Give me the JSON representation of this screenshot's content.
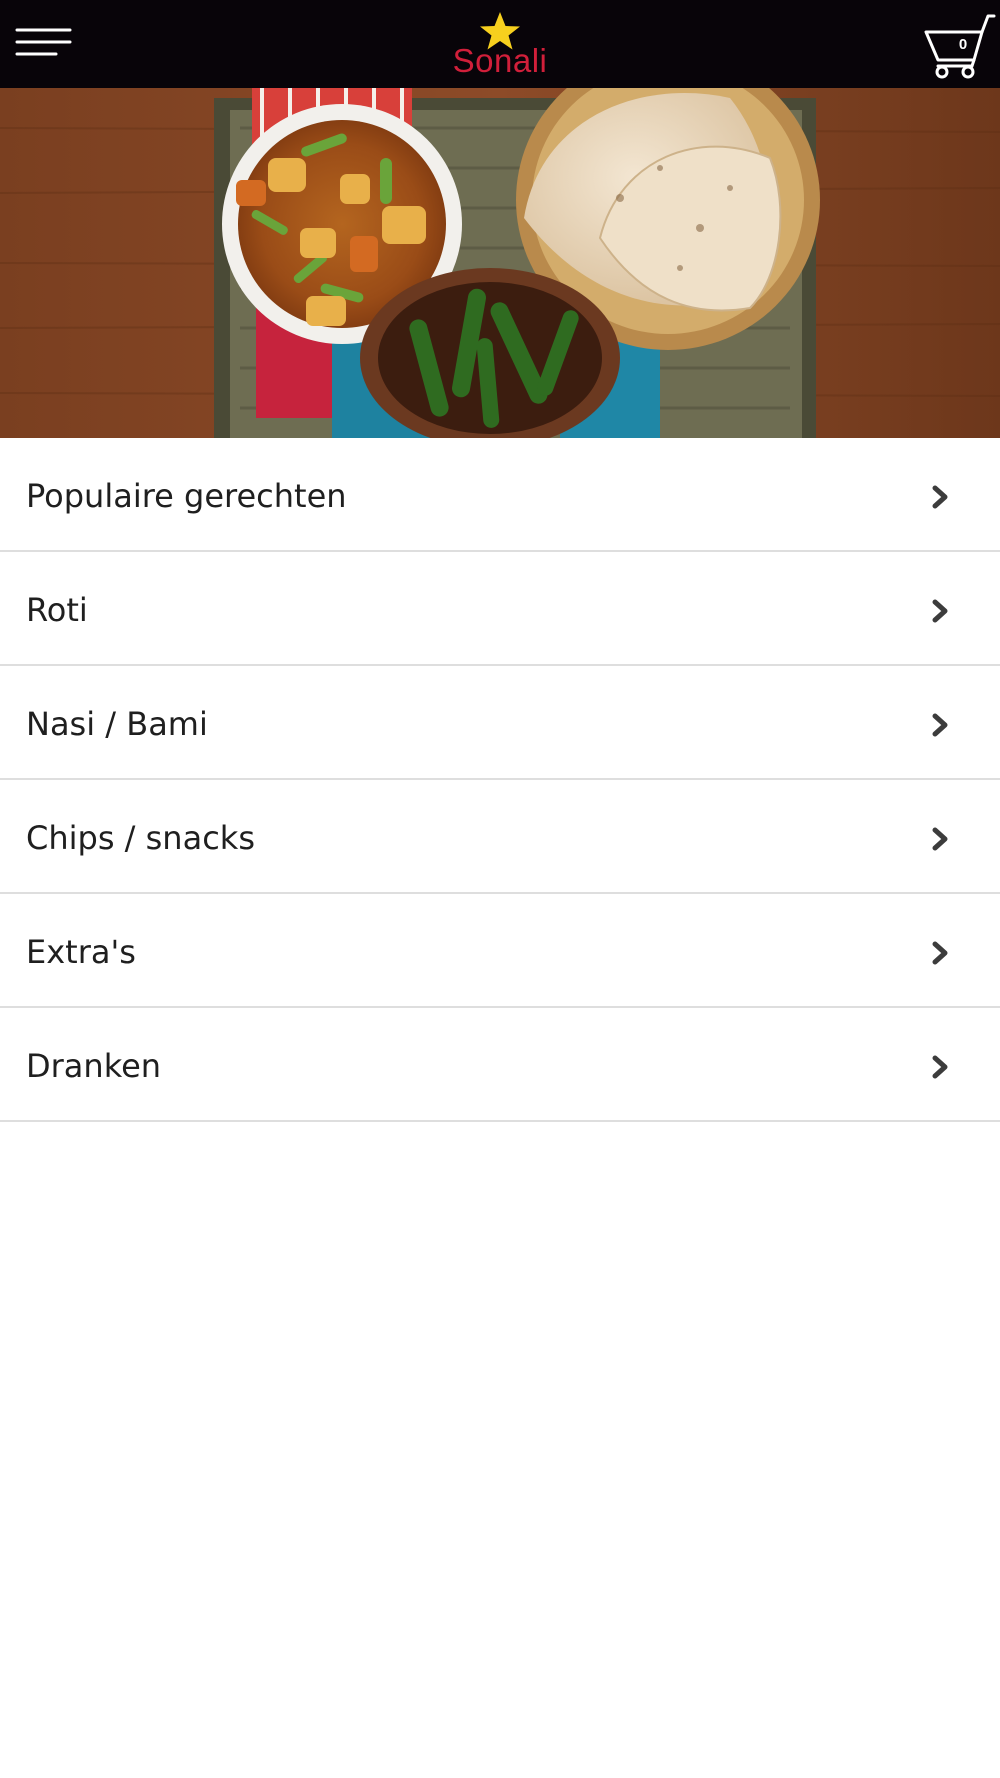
{
  "header": {
    "logo_text": "Sonali",
    "menu_icon": "hamburger-menu-icon",
    "cart_icon": "shopping-cart-icon",
    "cart_count": "0",
    "star_icon": "star-icon",
    "colors": {
      "background": "#080409",
      "logo_text": "#d11f3a",
      "star": "#f7d01e"
    }
  },
  "hero": {
    "image": "indian-food-banner"
  },
  "categories": [
    {
      "label": "Populaire gerechten"
    },
    {
      "label": "Roti"
    },
    {
      "label": "Nasi / Bami"
    },
    {
      "label": "Chips / snacks"
    },
    {
      "label": "Extra's"
    },
    {
      "label": "Dranken"
    }
  ]
}
